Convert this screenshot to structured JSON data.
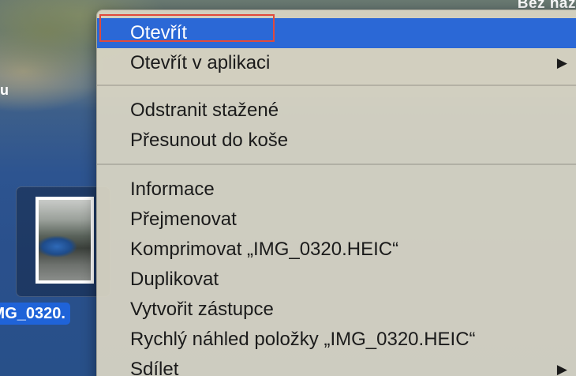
{
  "desktop": {
    "top_right_label": "Bez náz",
    "left_edge_text": "u",
    "file": {
      "name": "IMG_0320."
    }
  },
  "context_menu": {
    "items": [
      {
        "label": "Otevřít",
        "highlighted": true
      },
      {
        "label": "Otevřít v aplikaci",
        "has_submenu": true
      },
      {
        "label": "Odstranit stažené"
      },
      {
        "label": "Přesunout do koše"
      },
      {
        "label": "Informace"
      },
      {
        "label": "Přejmenovat"
      },
      {
        "label": "Komprimovat „IMG_0320.HEIC“"
      },
      {
        "label": "Duplikovat"
      },
      {
        "label": "Vytvořit zástupce"
      },
      {
        "label": "Rychlý náhled položky „IMG_0320.HEIC“"
      },
      {
        "label": "Sdílet",
        "has_submenu": true
      }
    ],
    "submenu_arrow": "▶",
    "colors": {
      "highlight": "#2b68d6",
      "annotation_box": "#e04a3c"
    }
  }
}
